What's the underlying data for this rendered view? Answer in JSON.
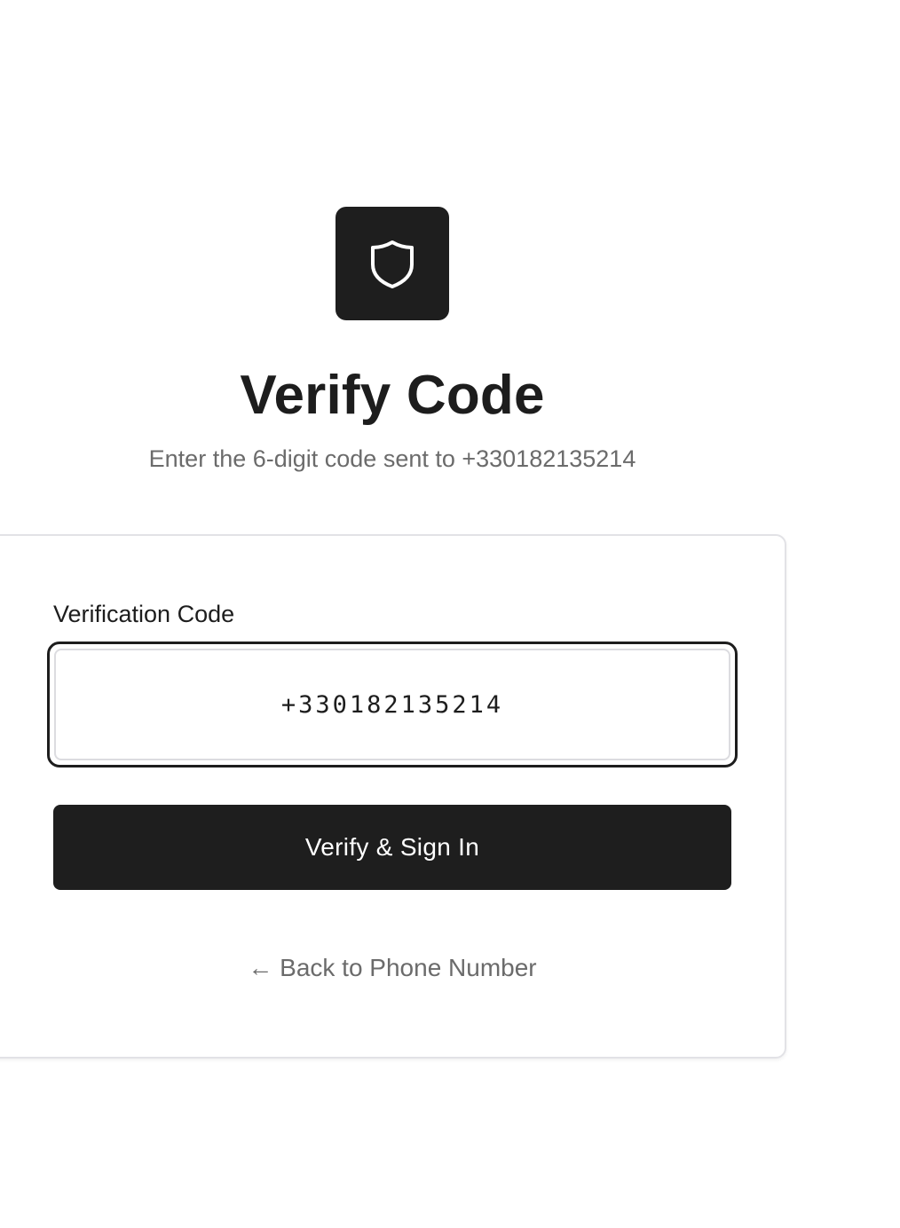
{
  "header": {
    "logo_icon": "shield-icon",
    "title": "Verify Code",
    "subtitle": "Enter the 6-digit code sent to +330182135214"
  },
  "form": {
    "code_label": "Verification Code",
    "code_value": "+330182135214",
    "submit_label": "Verify & Sign In",
    "back_link_label": "← Back to Phone Number"
  },
  "colors": {
    "primary": "#1e1e1e",
    "muted_text": "#6b6b6b",
    "card_border": "#e2e2e6"
  }
}
